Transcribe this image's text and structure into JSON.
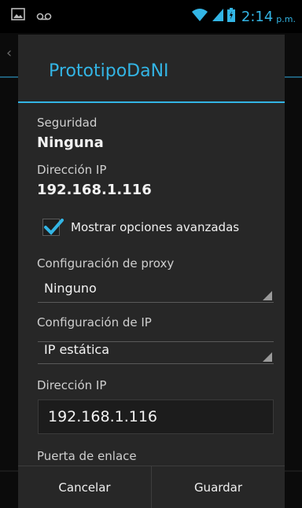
{
  "status_bar": {
    "time": "2:14",
    "ampm": "p.m.",
    "left_icons": [
      "image-icon",
      "voicemail-icon"
    ],
    "right_icons": [
      "wifi-icon",
      "signal-icon",
      "battery-icon"
    ],
    "accent_color": "#33b5e5"
  },
  "dialog": {
    "title": "PrototipoDaNI",
    "security_label": "Seguridad",
    "security_value": "Ninguna",
    "ip_label": "Dirección IP",
    "ip_value": "192.168.1.116",
    "advanced_checkbox": {
      "label": "Mostrar opciones avanzadas",
      "checked": true
    },
    "proxy_label": "Configuración de proxy",
    "proxy_value": "Ninguno",
    "ip_settings_label": "Configuración de IP",
    "ip_settings_value": "IP estática",
    "ip_address_label": "Dirección IP",
    "ip_address_input": "192.168.1.116",
    "gateway_label": "Puerta de enlace",
    "buttons": {
      "cancel": "Cancelar",
      "save": "Guardar"
    }
  }
}
